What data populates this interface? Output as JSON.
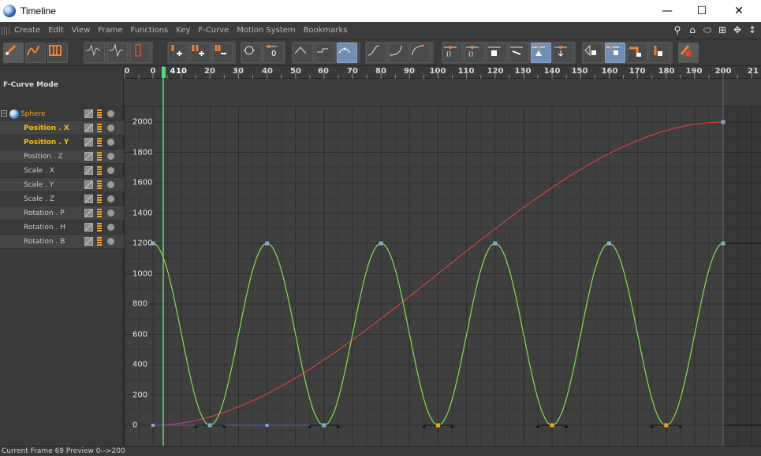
{
  "window": {
    "title": "Timeline",
    "minimize": "—",
    "maximize": "☐",
    "close": "✕"
  },
  "menu": [
    "Create",
    "Edit",
    "View",
    "Frame",
    "Functions",
    "Key",
    "F-Curve",
    "Motion System",
    "Bookmarks"
  ],
  "left_panel": {
    "mode_label": "F-Curve Mode",
    "tracks": [
      {
        "label": "Sphere",
        "kind": "root"
      },
      {
        "label": "Position . X",
        "kind": "selected"
      },
      {
        "label": "Position . Y",
        "kind": "selected"
      },
      {
        "label": "Position . Z",
        "kind": "normal"
      },
      {
        "label": "Scale . X",
        "kind": "normal"
      },
      {
        "label": "Scale . Y",
        "kind": "normal"
      },
      {
        "label": "Scale . Z",
        "kind": "normal"
      },
      {
        "label": "Rotation . P",
        "kind": "normal"
      },
      {
        "label": "Rotation . H",
        "kind": "normal"
      },
      {
        "label": "Rotation . B",
        "kind": "normal"
      }
    ]
  },
  "ruler": {
    "ticks": [
      "0",
      "0",
      "10",
      "20",
      "30",
      "40",
      "50",
      "60",
      "70",
      "80",
      "90",
      "100",
      "110",
      "120",
      "130",
      "140",
      "150",
      "160",
      "170",
      "180",
      "190",
      "200",
      "21"
    ],
    "current_frame_label": "4"
  },
  "y_axis": [
    "2000",
    "1800",
    "1600",
    "1400",
    "1200",
    "1000",
    "800",
    "600",
    "400",
    "200",
    "0"
  ],
  "status": {
    "text": "Current Frame  69  Preview  0-->200"
  },
  "colors": {
    "pos_x_curve": "#d44040",
    "pos_y_curve": "#7fe04a",
    "pos_z_curve": "#4a4ad8",
    "playhead": "#4fe070"
  },
  "chart_data": {
    "type": "line",
    "x_range": [
      0,
      200
    ],
    "y_range": [
      0,
      2000
    ],
    "series": [
      {
        "name": "Position . X",
        "x": [
          0,
          200
        ],
        "y": [
          0,
          2000
        ]
      },
      {
        "name": "Position . Y",
        "x": [
          0,
          20,
          40,
          60,
          80,
          100,
          120,
          140,
          160,
          180,
          200
        ],
        "y": [
          1200,
          0,
          1200,
          0,
          1200,
          0,
          1200,
          0,
          1200,
          0,
          1200
        ]
      },
      {
        "name": "Position . Z",
        "x": [
          0,
          200
        ],
        "y": [
          0,
          0
        ]
      }
    ]
  }
}
